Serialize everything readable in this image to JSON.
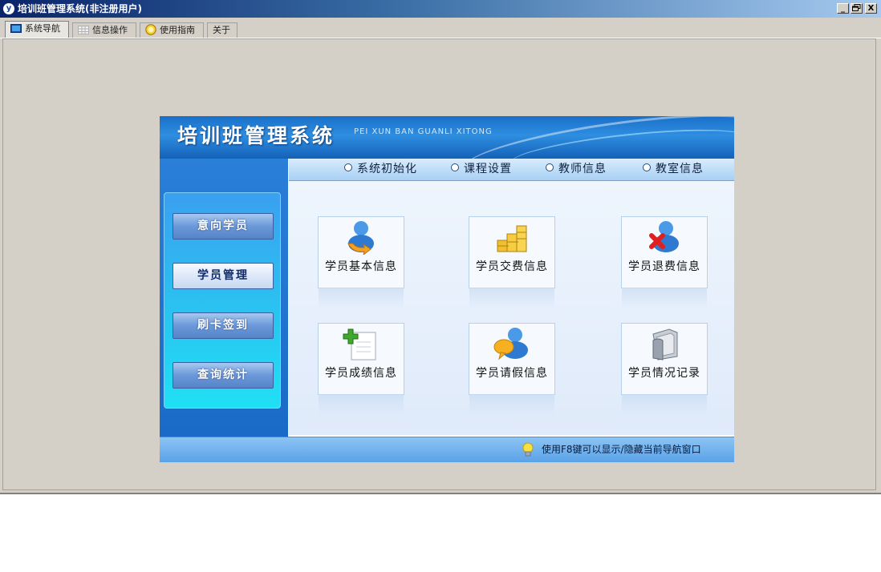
{
  "window": {
    "title": "培训班管理系统(非注册用户)",
    "controls": {
      "minimize": "_",
      "restore": "ᗡ",
      "close": "X"
    }
  },
  "tabs": [
    {
      "label": "系统导航",
      "icon": "monitor-icon",
      "active": true
    },
    {
      "label": "信息操作",
      "icon": "grid-icon",
      "active": false
    },
    {
      "label": "使用指南",
      "icon": "help-icon",
      "active": false
    },
    {
      "label": "关于",
      "icon": "",
      "active": false
    }
  ],
  "banner": {
    "title": "培训班管理系统",
    "subtitle": "PEI XUN BAN GUANLI XITONG"
  },
  "left_menu": [
    {
      "label": "意向学员",
      "active": false
    },
    {
      "label": "学员管理",
      "active": true
    },
    {
      "label": "刷卡签到",
      "active": false
    },
    {
      "label": "查询统计",
      "active": false
    }
  ],
  "top_nav": [
    {
      "label": "系统初始化"
    },
    {
      "label": "课程设置"
    },
    {
      "label": "教师信息"
    },
    {
      "label": "教室信息"
    }
  ],
  "cards": [
    {
      "label": "学员基本信息",
      "icon": "student-refresh-icon"
    },
    {
      "label": "学员交费信息",
      "icon": "coins-icon"
    },
    {
      "label": "学员退费信息",
      "icon": "student-remove-icon"
    },
    {
      "label": "学员成绩信息",
      "icon": "add-document-icon"
    },
    {
      "label": "学员请假信息",
      "icon": "student-chat-icon"
    },
    {
      "label": "学员情况记录",
      "icon": "folder-icon"
    }
  ],
  "status": {
    "hint": "使用F8键可以显示/隐藏当前导航窗口",
    "icon": "lightbulb-icon"
  },
  "colors": {
    "titlebar_start": "#0a246a",
    "banner_blue": "#1a6fc8",
    "menu_cyan": "#28c6f0",
    "window_gray": "#d4d0c8"
  }
}
